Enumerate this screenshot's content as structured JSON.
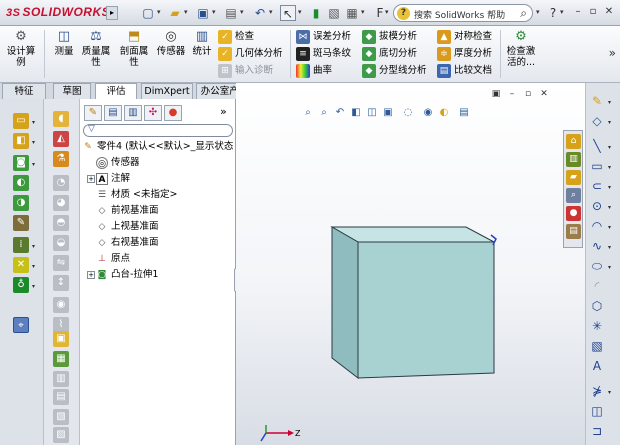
{
  "app": {
    "logo_prefix": "3S",
    "logo_text": "SOLIDWORKS",
    "search_placeholder": "搜索 SolidWorks 帮助",
    "help_icon": "?",
    "search_icon": "⌕"
  },
  "ribbon": {
    "big_buttons": [
      {
        "label": "设计算\n例",
        "icon": "calculator-icon"
      },
      {
        "label": "测量",
        "icon": "measure-icon"
      },
      {
        "label": "质量属\n性",
        "icon": "mass-properties-icon"
      },
      {
        "label": "剖面属\n性",
        "icon": "section-properties-icon"
      },
      {
        "label": "传感器",
        "icon": "sensor-icon"
      },
      {
        "label": "统计",
        "icon": "statistics-icon"
      }
    ],
    "col1": [
      {
        "label": "检查",
        "disabled": false
      },
      {
        "label": "几何体分析",
        "disabled": false
      },
      {
        "label": "输入诊断",
        "disabled": true
      }
    ],
    "col2": [
      {
        "label": "误差分析"
      },
      {
        "label": "斑马条纹"
      },
      {
        "label": "曲率"
      }
    ],
    "col3": [
      {
        "label": "拔模分析"
      },
      {
        "label": "底切分析"
      },
      {
        "label": "分型线分析"
      }
    ],
    "col4": [
      {
        "label": "对称检查"
      },
      {
        "label": "厚度分析"
      },
      {
        "label": "比较文档"
      }
    ],
    "check_activity": {
      "label": "检查激\n活的..."
    },
    "more": "»"
  },
  "tabs": [
    {
      "label": "特征",
      "active": false
    },
    {
      "label": "草图",
      "active": false
    },
    {
      "label": "评估",
      "active": true
    },
    {
      "label": "DimXpert",
      "active": false
    },
    {
      "label": "办公室产品",
      "active": false
    }
  ],
  "feature_tree": {
    "more": "»",
    "filter_icon": "▽",
    "items": [
      {
        "label": "零件4 (默认<<默认>_显示状态",
        "indent": 0,
        "expander": ""
      },
      {
        "label": "传感器",
        "indent": 2,
        "expander": ""
      },
      {
        "label": "注解",
        "indent": 2,
        "expander": "+"
      },
      {
        "label": "材质 <未指定>",
        "indent": 2,
        "expander": ""
      },
      {
        "label": "前视基准面",
        "indent": 2,
        "expander": ""
      },
      {
        "label": "上视基准面",
        "indent": 2,
        "expander": ""
      },
      {
        "label": "右视基准面",
        "indent": 2,
        "expander": ""
      },
      {
        "label": "原点",
        "indent": 2,
        "expander": ""
      },
      {
        "label": "凸台-拉伸1",
        "indent": 2,
        "expander": "+"
      }
    ]
  },
  "triad": {
    "x_label": "Z",
    "y_label": "Y"
  },
  "colors": {
    "cube_front": "#a8d2d2",
    "cube_top": "#c7e4e4",
    "cube_side": "#8fbcbf",
    "cube_edge": "#2c3a44",
    "accent_blue": "#2a4f8c"
  }
}
